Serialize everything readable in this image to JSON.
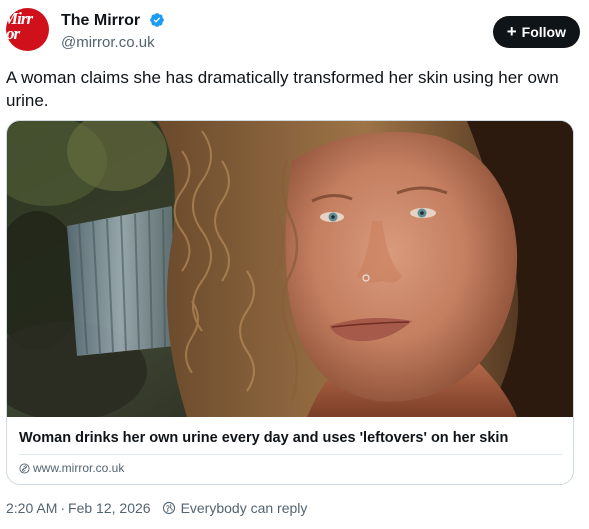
{
  "author": {
    "display_name": "The Mirror",
    "handle": "@mirror.co.uk",
    "avatar_text_line1": "Mirr",
    "avatar_text_line2": "or",
    "avatar_color": "#d0111b",
    "verified": true,
    "verified_icon": "verified-badge-icon",
    "verified_color": "#1d9bf0"
  },
  "follow_button": {
    "label": "Follow",
    "icon": "plus-icon"
  },
  "tweet": {
    "text": "A woman claims she has dramatically transformed her skin using her own urine."
  },
  "link_card": {
    "image_description_icon": "photo",
    "title": "Woman drinks her own urine every day and uses 'leftovers' on her skin",
    "domain": "www.mirror.co.uk",
    "domain_icon": "link-icon"
  },
  "meta": {
    "time": "2:20 AM",
    "separator": "·",
    "date": "Feb 12, 2026",
    "reply_setting": "Everybody can reply",
    "reply_icon": "globe-icon"
  }
}
